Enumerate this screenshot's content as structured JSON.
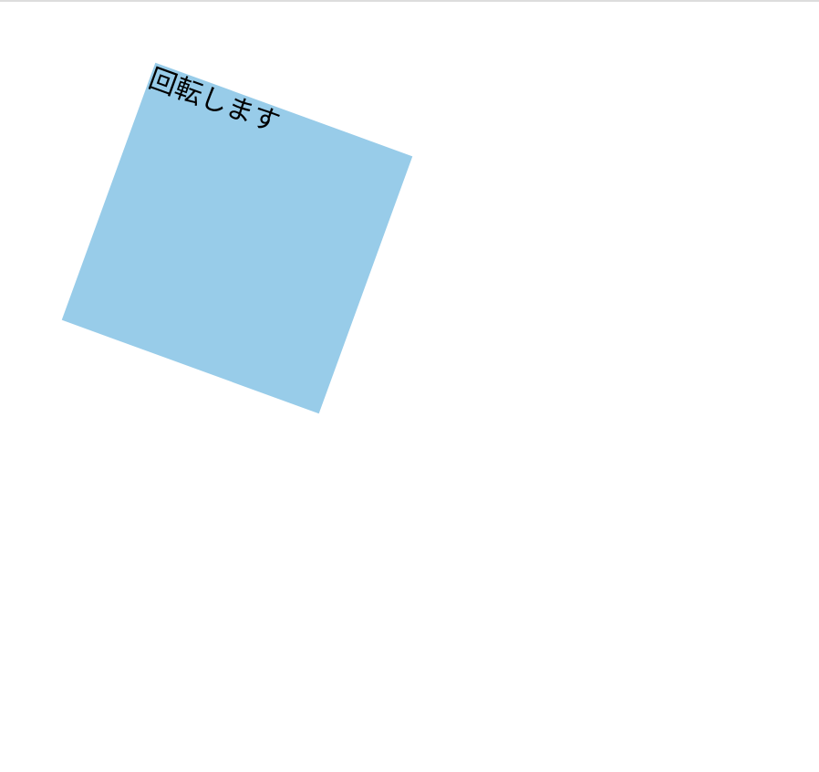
{
  "rotated_box": {
    "label": "回転します",
    "rotation_deg": 20,
    "fill_color": "#98cce9",
    "text_color": "#000000"
  },
  "page": {
    "background_color": "#ffffff",
    "top_rule_color": "#dddddd"
  }
}
